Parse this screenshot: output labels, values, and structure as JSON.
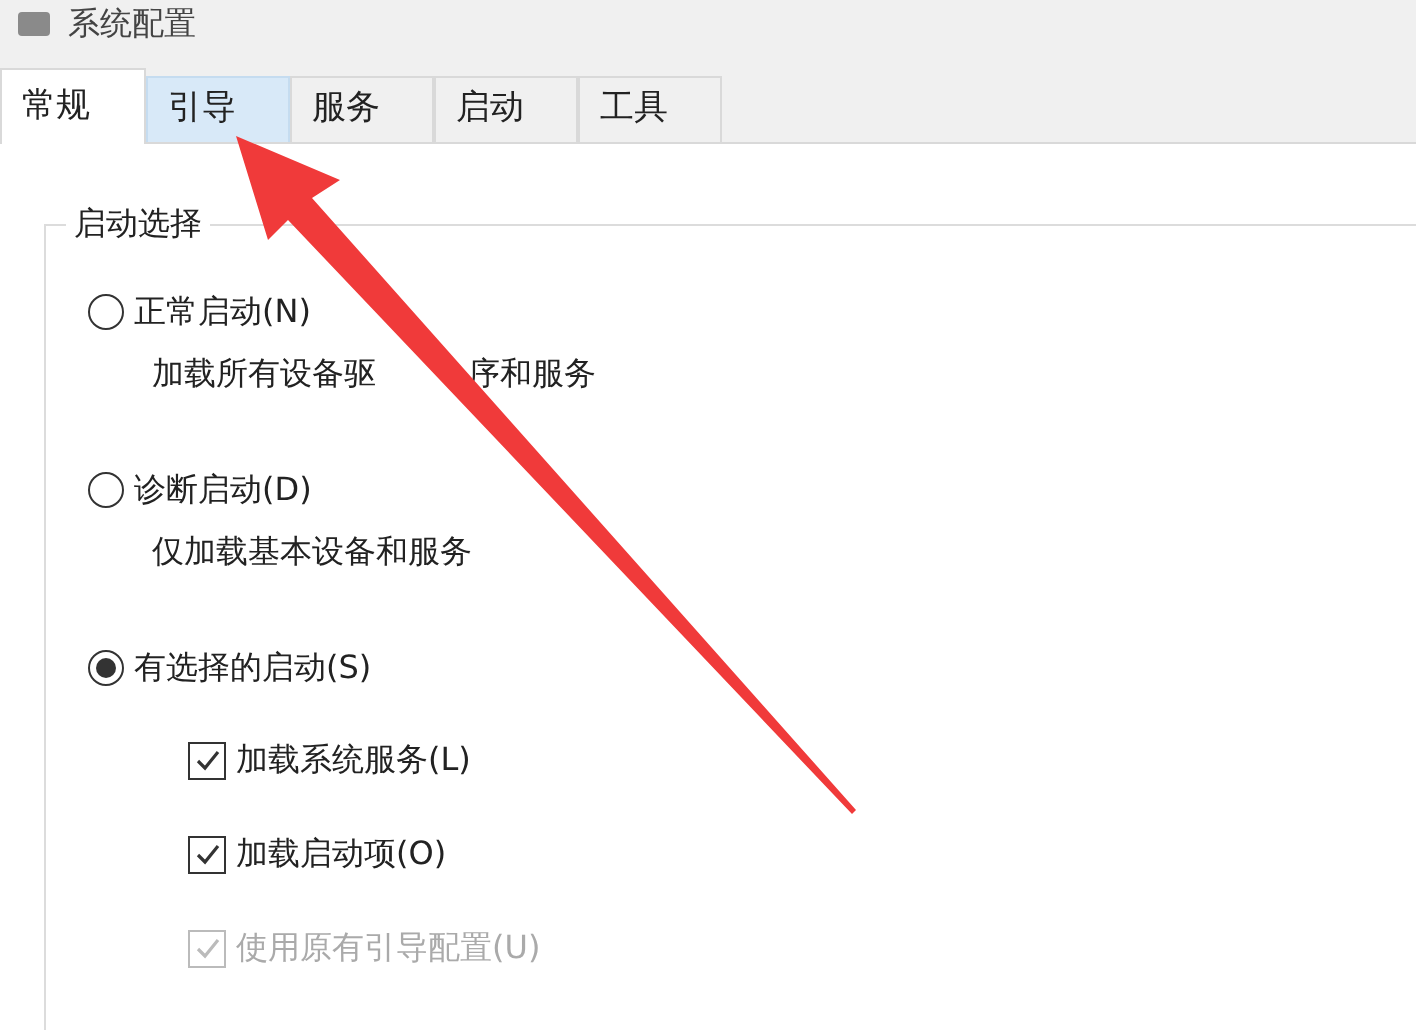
{
  "window": {
    "title": "系统配置"
  },
  "tabs": [
    {
      "label": "常规",
      "selected": true,
      "hovered": false
    },
    {
      "label": "引导",
      "selected": false,
      "hovered": true
    },
    {
      "label": "服务",
      "selected": false,
      "hovered": false
    },
    {
      "label": "启动",
      "selected": false,
      "hovered": false
    },
    {
      "label": "工具",
      "selected": false,
      "hovered": false
    }
  ],
  "startup_group": {
    "legend": "启动选择",
    "options": [
      {
        "label": "正常启动(N)",
        "selected": false,
        "description": [
          "加载所有设备驱",
          "序和服务"
        ]
      },
      {
        "label": "诊断启动(D)",
        "selected": false,
        "description": [
          "仅加载基本设备和服务"
        ]
      },
      {
        "label": "有选择的启动(S)",
        "selected": true,
        "checkboxes": [
          {
            "label": "加载系统服务(L)",
            "checked": true,
            "disabled": false
          },
          {
            "label": "加载启动项(O)",
            "checked": true,
            "disabled": false
          },
          {
            "label": "使用原有引导配置(U)",
            "checked": true,
            "disabled": true
          }
        ]
      }
    ]
  }
}
